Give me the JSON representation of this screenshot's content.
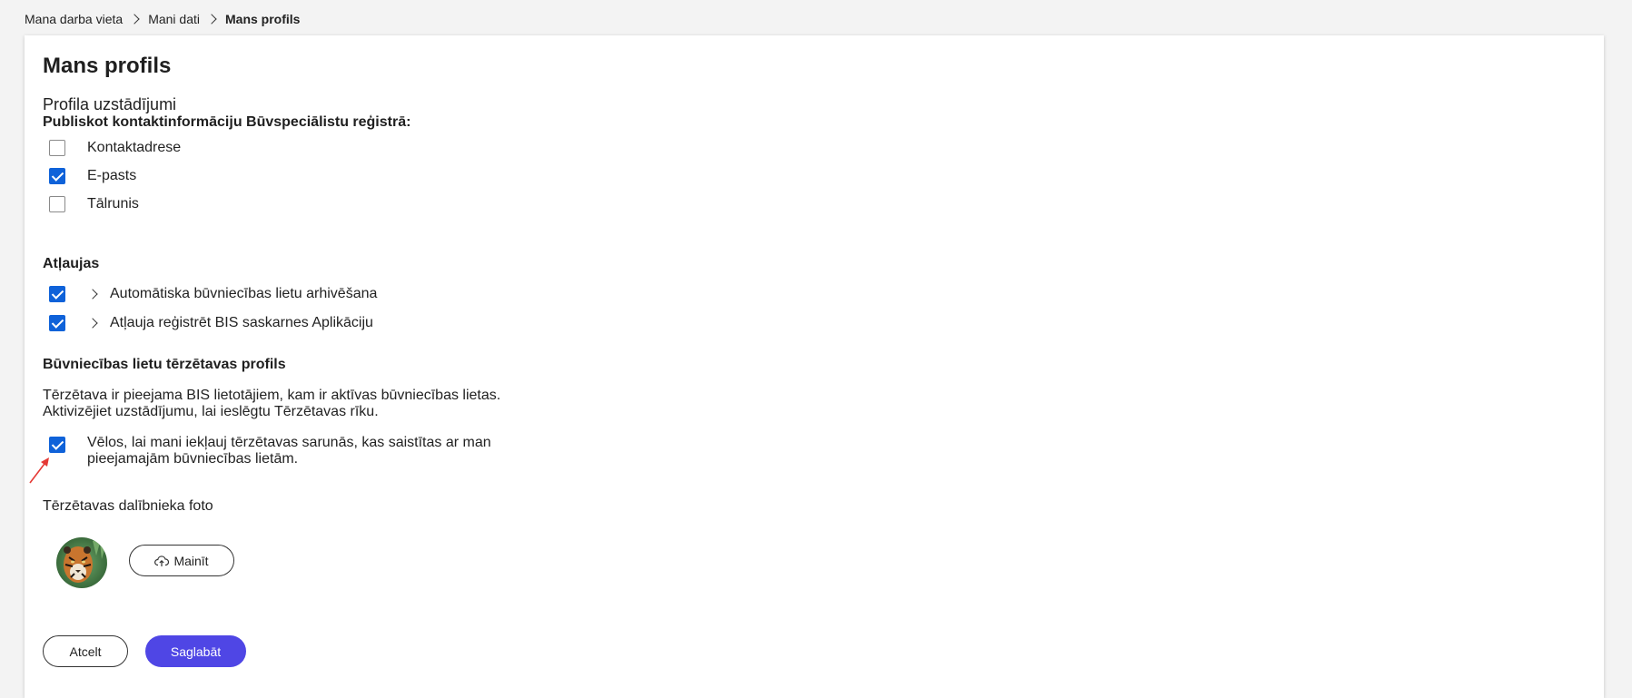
{
  "breadcrumb": {
    "items": [
      "Mana darba vieta",
      "Mani dati",
      "Mans profils"
    ]
  },
  "page": {
    "title": "Mans profils",
    "subtitle": "Profila uzstādījumi"
  },
  "publish_section": {
    "heading": "Publiskot kontaktinformāciju Būvspeciālistu reģistrā:",
    "options": [
      {
        "label": "Kontaktadrese",
        "checked": false
      },
      {
        "label": "E-pasts",
        "checked": true
      },
      {
        "label": "Tālrunis",
        "checked": false
      }
    ]
  },
  "permissions_section": {
    "heading": "Atļaujas",
    "items": [
      {
        "label": "Automātiska būvniecības lietu arhivēšana",
        "checked": true
      },
      {
        "label": "Atļauja reģistrēt BIS saskarnes Aplikāciju",
        "checked": true
      }
    ]
  },
  "chat_section": {
    "heading": "Būvniecības lietu tērzētavas profils",
    "info_line1": "Tērzētava ir pieejama BIS lietotājiem, kam ir aktīvas būvniecības lietas.",
    "info_line2": "Aktivizējiet uzstādījumu, lai ieslēgtu Tērzētavas rīku.",
    "consent_label": "Vēlos, lai mani iekļauj tērzētavas sarunās, kas saistītas ar man pieejamajām būvniecības lietām.",
    "consent_checked": true,
    "photo_label": "Tērzētavas dalībnieka foto",
    "change_label": "Mainīt"
  },
  "actions": {
    "cancel_label": "Atcelt",
    "save_label": "Saglabāt"
  },
  "colors": {
    "accent": "#4f46e5",
    "checkbox": "#0f62d9",
    "annotation": "#e53935"
  },
  "icons": {
    "breadcrumb_separator": "chevron-right-icon",
    "expand": "chevron-right-icon",
    "upload": "cloud-upload-icon",
    "annotation": "red-arrow-icon"
  }
}
